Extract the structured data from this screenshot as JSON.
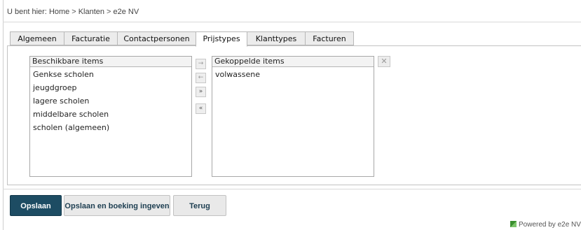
{
  "breadcrumb": {
    "prefix": "U bent hier:",
    "items": [
      "Home",
      "Klanten",
      "e2e NV"
    ],
    "separator": ">"
  },
  "tabs": [
    {
      "label": "Algemeen",
      "active": false
    },
    {
      "label": "Facturatie",
      "active": false
    },
    {
      "label": "Contactpersonen",
      "active": false
    },
    {
      "label": "Prijstypes",
      "active": true
    },
    {
      "label": "Klanttypes",
      "active": false
    },
    {
      "label": "Facturen",
      "active": false
    }
  ],
  "available": {
    "header": "Beschikbare items",
    "items": [
      "Genkse scholen",
      "jeugdgroep",
      "lagere scholen",
      "middelbare scholen",
      "scholen (algemeen)"
    ]
  },
  "linked": {
    "header": "Gekoppelde items",
    "items": [
      "volwassene"
    ]
  },
  "shuttle": {
    "add": "→",
    "remove": "←",
    "add_all": "»",
    "remove_all": "«"
  },
  "clear": "✕",
  "buttons": {
    "save": "Opslaan",
    "save_and_book": "Opslaan en boeking ingeven",
    "back": "Terug"
  },
  "footer": {
    "powered": "Powered by e2e NV"
  },
  "colors": {
    "primary_button": "#1d4c63"
  }
}
